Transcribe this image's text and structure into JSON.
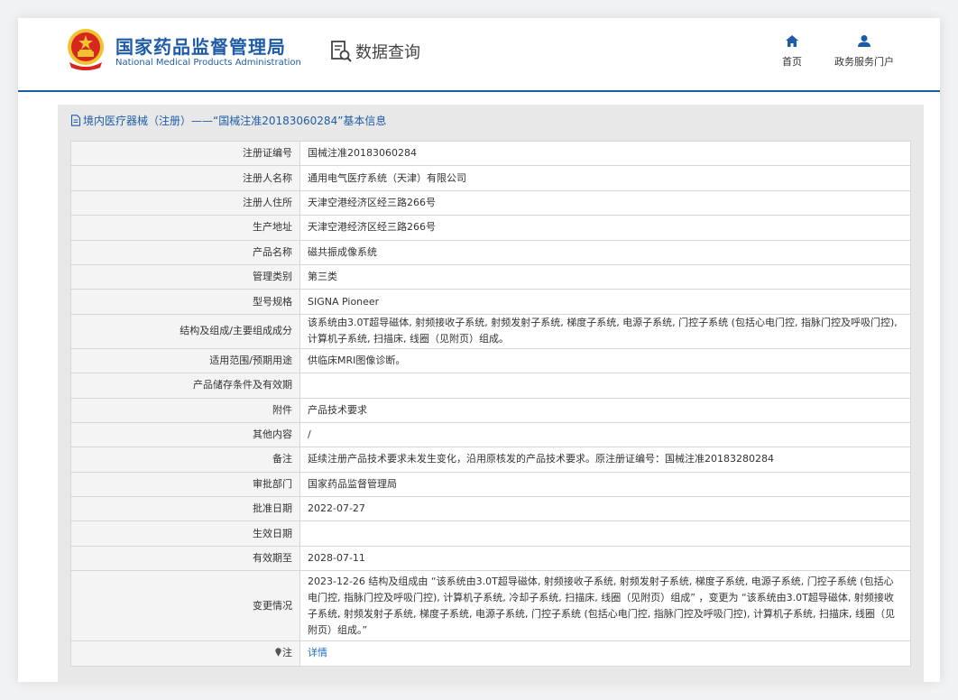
{
  "header": {
    "org_name_cn": "国家药品监督管理局",
    "org_name_en": "National Medical Products Administration",
    "query_label": "数据查询",
    "nav": {
      "home": "首页",
      "portal": "政务服务门户"
    },
    "colors": {
      "brand_blue": "#1f5ca8",
      "link_blue": "#1f6fc5",
      "emblem_red": "#d7261e",
      "emblem_gold": "#f2c230"
    }
  },
  "panel": {
    "title": "境内医疗器械（注册）——“国械注准20183060284”基本信息"
  },
  "rows": [
    {
      "label": "注册证编号",
      "value": "国械注准20183060284"
    },
    {
      "label": "注册人名称",
      "value": "通用电气医疗系统（天津）有限公司"
    },
    {
      "label": "注册人住所",
      "value": "天津空港经济区经三路266号"
    },
    {
      "label": "生产地址",
      "value": "天津空港经济区经三路266号"
    },
    {
      "label": "产品名称",
      "value": "磁共振成像系统"
    },
    {
      "label": "管理类别",
      "value": "第三类"
    },
    {
      "label": "型号规格",
      "value": "SIGNA Pioneer"
    },
    {
      "label": "结构及组成/主要组成成分",
      "value": "该系统由3.0T超导磁体, 射频接收子系统, 射频发射子系统, 梯度子系统, 电源子系统, 门控子系统 (包括心电门控, 指脉门控及呼吸门控), 计算机子系统, 扫描床, 线圈（见附页）组成。"
    },
    {
      "label": "适用范围/预期用途",
      "value": "供临床MRI图像诊断。"
    },
    {
      "label": "产品储存条件及有效期",
      "value": ""
    },
    {
      "label": "附件",
      "value": "产品技术要求"
    },
    {
      "label": "其他内容",
      "value": "/"
    },
    {
      "label": "备注",
      "value": "延续注册产品技术要求未发生变化，沿用原核发的产品技术要求。原注册证编号：国械注准20183280284"
    },
    {
      "label": "审批部门",
      "value": "国家药品监督管理局"
    },
    {
      "label": "批准日期",
      "value": "2022-07-27"
    },
    {
      "label": "生效日期",
      "value": ""
    },
    {
      "label": "有效期至",
      "value": "2028-07-11"
    },
    {
      "label": "变更情况",
      "value": "2023-12-26 结构及组成由 “该系统由3.0T超导磁体, 射频接收子系统, 射频发射子系统, 梯度子系统, 电源子系统, 门控子系统 (包括心电门控, 指脉门控及呼吸门控), 计算机子系统, 冷却子系统, 扫描床, 线圈（见附页）组成” ，变更为 “该系统由3.0T超导磁体, 射频接收子系统, 射频发射子系统, 梯度子系统, 电源子系统, 门控子系统 (包括心电门控, 指脉门控及呼吸门控), 计算机子系统, 扫描床, 线圈（见附页）组成。”"
    }
  ],
  "note": {
    "label": "注",
    "link": "详情"
  }
}
